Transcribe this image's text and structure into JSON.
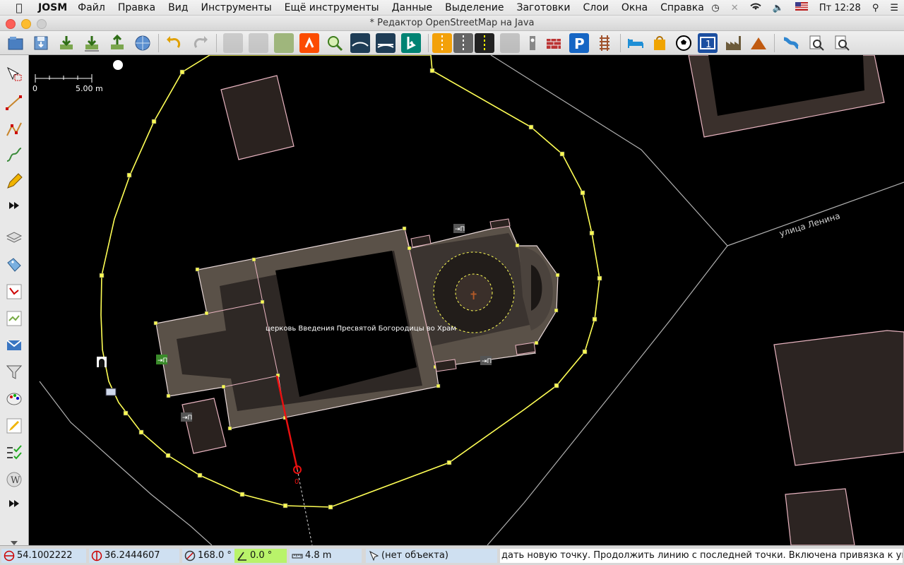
{
  "menubar": {
    "app_name": "JOSM",
    "items": [
      "Файл",
      "Правка",
      "Вид",
      "Инструменты",
      "Ещё инструменты",
      "Данные",
      "Выделение",
      "Заготовки",
      "Слои",
      "Окна",
      "Справка"
    ],
    "clock": "Пт 12:28"
  },
  "window": {
    "title": "* Редактор OpenStreetMap на Java"
  },
  "toolbar": {
    "icons": [
      "open-file",
      "save",
      "download",
      "download-along",
      "upload",
      "web-globe",
      "undo",
      "redo",
      "split-way",
      "combine-way",
      "reverse-way",
      "strava",
      "zoom-to",
      "road-service",
      "road-bridge",
      "bing",
      "amenity-yellow",
      "oneway",
      "lit-road",
      "traffic-signals",
      "barrier",
      "brick-wall",
      "parking",
      "railway",
      "hotel",
      "shop-bag",
      "sports-ball",
      "route-sign",
      "industrial",
      "peak",
      "waterway",
      "search",
      "search-zoom"
    ]
  },
  "left_toolbar": {
    "icons": [
      "select-tool",
      "draw-tool",
      "improve-way",
      "draw-curve",
      "pencil-draw",
      "more-tools",
      "layers",
      "tags",
      "relation",
      "conflict",
      "merge",
      "filter",
      "style",
      "edit-map",
      "validator",
      "wiki",
      "more-tools-2"
    ]
  },
  "map": {
    "scale_min": "0",
    "scale_max": "5.00 m",
    "church_label": "церковь Введения Пресвятой Богородицы во Храм",
    "street_label": "улица Ленина",
    "entrance_badge": "⇥П",
    "draw_cursor_label": "0"
  },
  "status": {
    "latitude": "54.1002222",
    "longitude": "36.2444607",
    "heading": "168.0 °",
    "angle": "0.0 °",
    "distance": "4.8 m",
    "object": "(нет объекта)",
    "help": "дать новую точку. Продолжить линию с последней точки. Включена привязка к углам."
  },
  "colors": {
    "map_background": "#000000",
    "building_fill": "#5a5148",
    "building_outline": "#e8b4c0",
    "fence": "#ffff55",
    "draw_line": "#e81010",
    "angle_indicator": "#b9f36a"
  }
}
